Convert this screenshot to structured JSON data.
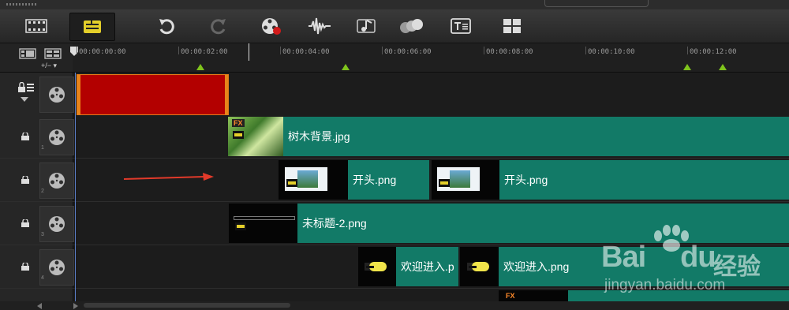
{
  "toolbar": {
    "buttons": [
      {
        "name": "storyboard-view-button",
        "icon": "film-icon"
      },
      {
        "name": "timeline-view-button",
        "icon": "timeline-icon",
        "active": true
      },
      {
        "name": "undo-button",
        "icon": "undo-icon"
      },
      {
        "name": "redo-button",
        "icon": "redo-icon"
      },
      {
        "name": "record-capture-button",
        "icon": "record-icon"
      },
      {
        "name": "sound-mixer-button",
        "icon": "audio-wave-icon"
      },
      {
        "name": "auto-music-button",
        "icon": "music-icon"
      },
      {
        "name": "motion-track-button",
        "icon": "spheres-icon"
      },
      {
        "name": "subtitle-editor-button",
        "icon": "title-icon"
      },
      {
        "name": "multi-camera-button",
        "icon": "grid-icon"
      }
    ]
  },
  "ruler": {
    "zoom_label": "+/− ▾",
    "ticks": [
      "00:00:00:00",
      "00:00:02:00",
      "00:00:04:00",
      "00:00:06:00",
      "00:00:08:00",
      "00:00:10:00",
      "00:00:12:00"
    ]
  },
  "tracks": [
    {
      "number": "",
      "clips": [
        {
          "name": "",
          "kind": "color"
        }
      ]
    },
    {
      "number": "1",
      "clips": [
        {
          "name": "树木背景.jpg",
          "kind": "photo-fx"
        }
      ]
    },
    {
      "number": "2",
      "clips": [
        {
          "name": "开头.png",
          "kind": "image"
        },
        {
          "name": "开头.png",
          "kind": "image"
        }
      ]
    },
    {
      "number": "3",
      "clips": [
        {
          "name": "未标题-2.png",
          "kind": "image"
        }
      ]
    },
    {
      "number": "4",
      "clips": [
        {
          "name": "欢迎进入.p",
          "kind": "image"
        },
        {
          "name": "欢迎进入.png",
          "kind": "image"
        }
      ]
    },
    {
      "number": "",
      "clips": [
        {
          "name": "",
          "kind": "fx"
        }
      ]
    }
  ],
  "fx_label": "FX",
  "watermark": {
    "brand_a": "Bai",
    "brand_b": "du",
    "brand_cn": "经验",
    "url": "jingyan.baidu.com"
  },
  "colors": {
    "clip": "#127a67",
    "color_clip": "#b30000",
    "marker": "#7fc31c",
    "accent": "#e4cf2a"
  }
}
